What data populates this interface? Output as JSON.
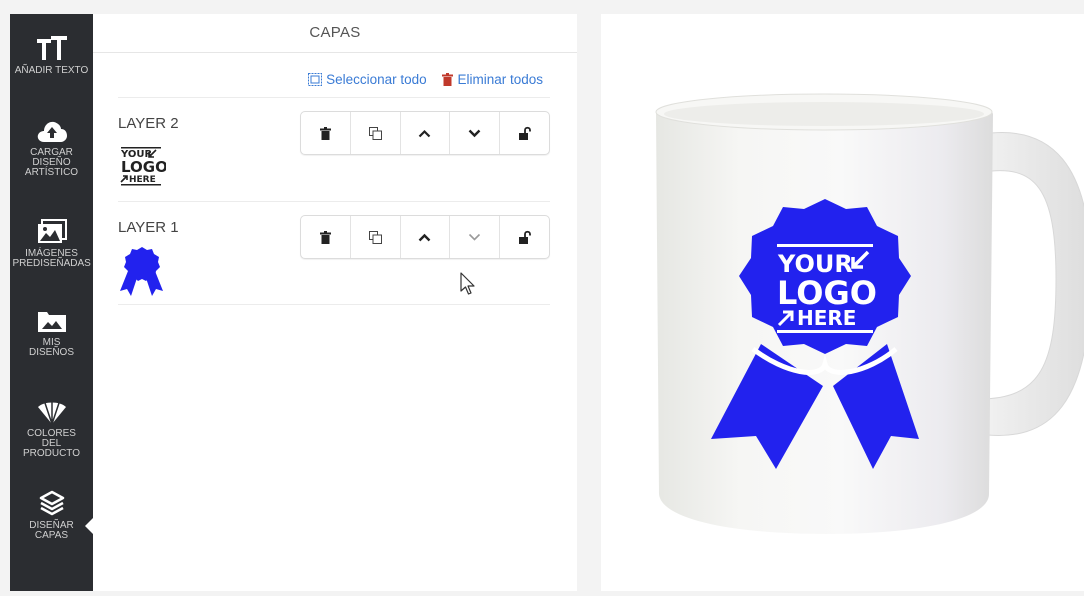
{
  "toolbar": {
    "items": [
      {
        "id": "add-text",
        "label": "AÑADIR TEXTO",
        "icon": "text-size-icon"
      },
      {
        "id": "upload-art",
        "label": "CARGAR DISEÑO ARTÍSTICO",
        "icon": "cloud-upload-icon"
      },
      {
        "id": "clipart",
        "label": "IMÁGENES PREDISEÑADAS",
        "icon": "images-icon"
      },
      {
        "id": "my-designs",
        "label": "MIS DISEÑOS",
        "icon": "folder-image-icon"
      },
      {
        "id": "product-colors",
        "label": "COLORES DEL PRODUCTO",
        "icon": "color-fan-icon"
      },
      {
        "id": "design-layers",
        "label": "DISEÑAR CAPAS",
        "icon": "layers-icon",
        "active": true
      }
    ]
  },
  "panel": {
    "title": "CAPAS",
    "select_all": "Seleccionar todo",
    "delete_all": "Eliminar todos"
  },
  "layers": [
    {
      "name": "LAYER 2",
      "thumbnail": "your-logo-here-text",
      "up_enabled": true,
      "down_enabled": true
    },
    {
      "name": "LAYER 1",
      "thumbnail": "award-ribbon",
      "up_enabled": true,
      "down_enabled": false
    }
  ],
  "preview": {
    "product": "white mug",
    "logo_lines": [
      "YOUR",
      "LOGO",
      "HERE"
    ],
    "logo_color": "#2222ee"
  },
  "colors": {
    "sidebar_bg": "#2b2d31",
    "link": "#3a7bd5",
    "danger_icon": "#c0392b",
    "logo_blue": "#2222ee"
  }
}
